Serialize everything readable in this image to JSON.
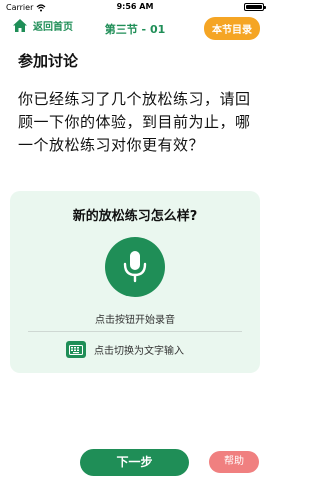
{
  "status_bar": {
    "carrier": "Carrier",
    "time": "9:56 AM"
  },
  "header": {
    "home_label": "返回首页",
    "section_label": "第三节 - 01",
    "toc_label": "本节目录"
  },
  "content": {
    "title": "参加讨论",
    "prompt": "你已经练习了几个放松练习，请回顾一下你的体验，到目前为止，哪一个放松练习对你更有效？"
  },
  "record_card": {
    "question": "新的放松练习怎么样?",
    "record_hint": "点击按钮开始录音",
    "switch_label": "点击切换为文字输入"
  },
  "footer": {
    "next_label": "下一步",
    "help_label": "帮助"
  },
  "colors": {
    "brand_green": "#1f8e57",
    "toc_orange": "#f5a524",
    "help_pink": "#f08080",
    "card_bg": "#eaf7ef"
  }
}
